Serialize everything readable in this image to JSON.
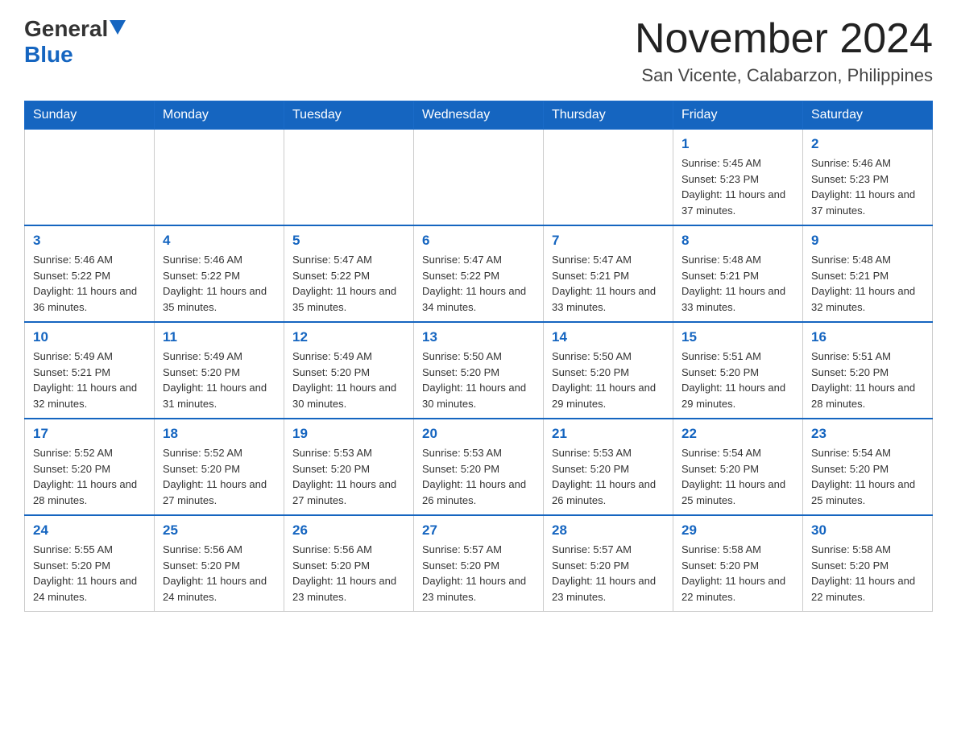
{
  "logo": {
    "general": "General",
    "blue": "Blue"
  },
  "header": {
    "month_year": "November 2024",
    "location": "San Vicente, Calabarzon, Philippines"
  },
  "days_of_week": [
    "Sunday",
    "Monday",
    "Tuesday",
    "Wednesday",
    "Thursday",
    "Friday",
    "Saturday"
  ],
  "weeks": [
    [
      {
        "day": "",
        "info": ""
      },
      {
        "day": "",
        "info": ""
      },
      {
        "day": "",
        "info": ""
      },
      {
        "day": "",
        "info": ""
      },
      {
        "day": "",
        "info": ""
      },
      {
        "day": "1",
        "info": "Sunrise: 5:45 AM\nSunset: 5:23 PM\nDaylight: 11 hours and 37 minutes."
      },
      {
        "day": "2",
        "info": "Sunrise: 5:46 AM\nSunset: 5:23 PM\nDaylight: 11 hours and 37 minutes."
      }
    ],
    [
      {
        "day": "3",
        "info": "Sunrise: 5:46 AM\nSunset: 5:22 PM\nDaylight: 11 hours and 36 minutes."
      },
      {
        "day": "4",
        "info": "Sunrise: 5:46 AM\nSunset: 5:22 PM\nDaylight: 11 hours and 35 minutes."
      },
      {
        "day": "5",
        "info": "Sunrise: 5:47 AM\nSunset: 5:22 PM\nDaylight: 11 hours and 35 minutes."
      },
      {
        "day": "6",
        "info": "Sunrise: 5:47 AM\nSunset: 5:22 PM\nDaylight: 11 hours and 34 minutes."
      },
      {
        "day": "7",
        "info": "Sunrise: 5:47 AM\nSunset: 5:21 PM\nDaylight: 11 hours and 33 minutes."
      },
      {
        "day": "8",
        "info": "Sunrise: 5:48 AM\nSunset: 5:21 PM\nDaylight: 11 hours and 33 minutes."
      },
      {
        "day": "9",
        "info": "Sunrise: 5:48 AM\nSunset: 5:21 PM\nDaylight: 11 hours and 32 minutes."
      }
    ],
    [
      {
        "day": "10",
        "info": "Sunrise: 5:49 AM\nSunset: 5:21 PM\nDaylight: 11 hours and 32 minutes."
      },
      {
        "day": "11",
        "info": "Sunrise: 5:49 AM\nSunset: 5:20 PM\nDaylight: 11 hours and 31 minutes."
      },
      {
        "day": "12",
        "info": "Sunrise: 5:49 AM\nSunset: 5:20 PM\nDaylight: 11 hours and 30 minutes."
      },
      {
        "day": "13",
        "info": "Sunrise: 5:50 AM\nSunset: 5:20 PM\nDaylight: 11 hours and 30 minutes."
      },
      {
        "day": "14",
        "info": "Sunrise: 5:50 AM\nSunset: 5:20 PM\nDaylight: 11 hours and 29 minutes."
      },
      {
        "day": "15",
        "info": "Sunrise: 5:51 AM\nSunset: 5:20 PM\nDaylight: 11 hours and 29 minutes."
      },
      {
        "day": "16",
        "info": "Sunrise: 5:51 AM\nSunset: 5:20 PM\nDaylight: 11 hours and 28 minutes."
      }
    ],
    [
      {
        "day": "17",
        "info": "Sunrise: 5:52 AM\nSunset: 5:20 PM\nDaylight: 11 hours and 28 minutes."
      },
      {
        "day": "18",
        "info": "Sunrise: 5:52 AM\nSunset: 5:20 PM\nDaylight: 11 hours and 27 minutes."
      },
      {
        "day": "19",
        "info": "Sunrise: 5:53 AM\nSunset: 5:20 PM\nDaylight: 11 hours and 27 minutes."
      },
      {
        "day": "20",
        "info": "Sunrise: 5:53 AM\nSunset: 5:20 PM\nDaylight: 11 hours and 26 minutes."
      },
      {
        "day": "21",
        "info": "Sunrise: 5:53 AM\nSunset: 5:20 PM\nDaylight: 11 hours and 26 minutes."
      },
      {
        "day": "22",
        "info": "Sunrise: 5:54 AM\nSunset: 5:20 PM\nDaylight: 11 hours and 25 minutes."
      },
      {
        "day": "23",
        "info": "Sunrise: 5:54 AM\nSunset: 5:20 PM\nDaylight: 11 hours and 25 minutes."
      }
    ],
    [
      {
        "day": "24",
        "info": "Sunrise: 5:55 AM\nSunset: 5:20 PM\nDaylight: 11 hours and 24 minutes."
      },
      {
        "day": "25",
        "info": "Sunrise: 5:56 AM\nSunset: 5:20 PM\nDaylight: 11 hours and 24 minutes."
      },
      {
        "day": "26",
        "info": "Sunrise: 5:56 AM\nSunset: 5:20 PM\nDaylight: 11 hours and 23 minutes."
      },
      {
        "day": "27",
        "info": "Sunrise: 5:57 AM\nSunset: 5:20 PM\nDaylight: 11 hours and 23 minutes."
      },
      {
        "day": "28",
        "info": "Sunrise: 5:57 AM\nSunset: 5:20 PM\nDaylight: 11 hours and 23 minutes."
      },
      {
        "day": "29",
        "info": "Sunrise: 5:58 AM\nSunset: 5:20 PM\nDaylight: 11 hours and 22 minutes."
      },
      {
        "day": "30",
        "info": "Sunrise: 5:58 AM\nSunset: 5:20 PM\nDaylight: 11 hours and 22 minutes."
      }
    ]
  ]
}
